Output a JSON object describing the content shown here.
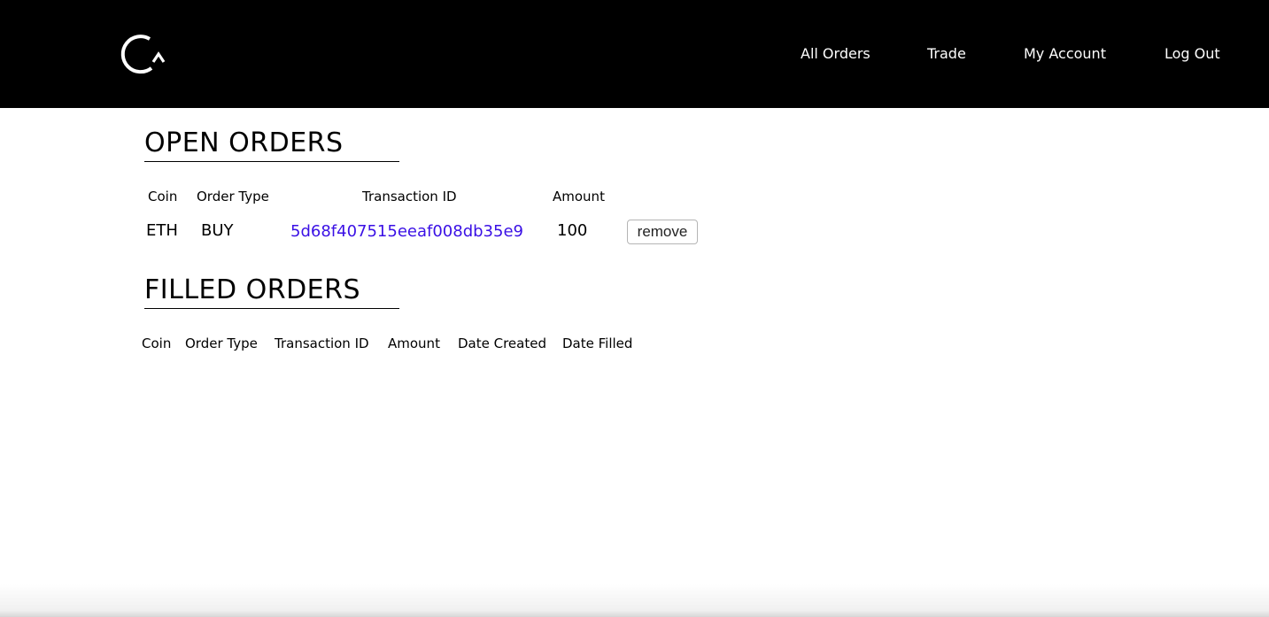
{
  "header": {
    "logo_icon": "circle-arrow-logo-icon",
    "nav": {
      "all_orders": "All Orders",
      "trade": "Trade",
      "my_account": "My Account",
      "log_out": "Log Out"
    }
  },
  "open_orders": {
    "title": "OPEN ORDERS",
    "columns": [
      "Coin",
      "Order Type",
      "Transaction ID",
      "Amount"
    ],
    "rows": [
      {
        "coin": "ETH",
        "order_type": "BUY",
        "transaction_id": "5d68f407515eeaf008db35e9",
        "amount": "100",
        "action_label": "remove"
      }
    ]
  },
  "filled_orders": {
    "title": "FILLED ORDERS",
    "columns": [
      "Coin",
      "Order Type",
      "Transaction ID",
      "Amount",
      "Date Created",
      "Date Filled"
    ],
    "rows": []
  },
  "colors": {
    "header_bg": "#000000",
    "link": "#3a10e5"
  }
}
